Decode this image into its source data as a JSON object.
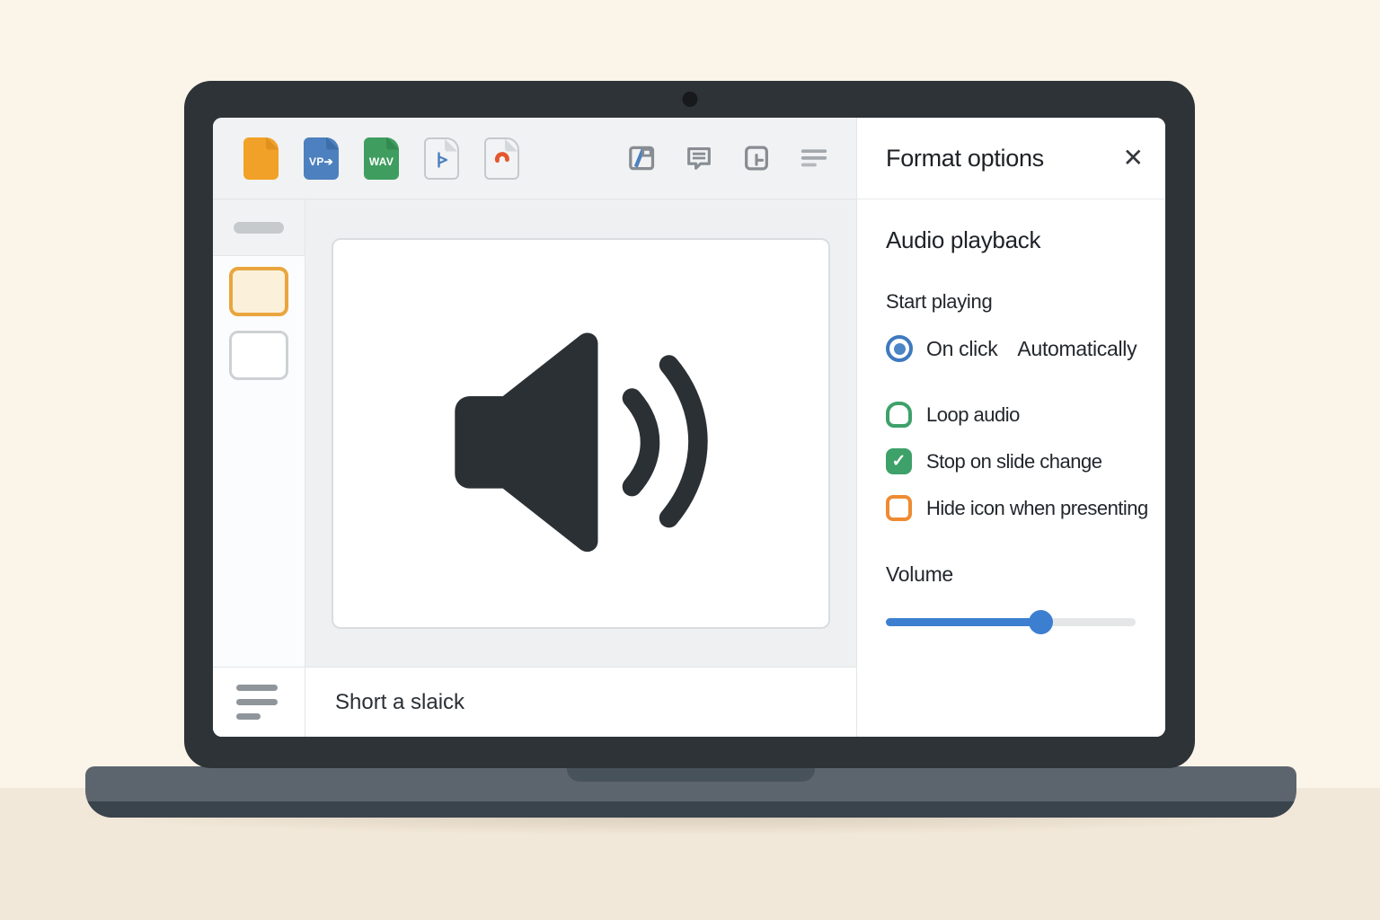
{
  "illustration": {
    "background_top": "#faf4e9",
    "background_floor": "#f2e8d9",
    "laptop_bezel": "#2e3337",
    "laptop_base_top": "#5c656e",
    "laptop_base_bottom": "#3a444d"
  },
  "toolbar": {
    "file_icons": [
      {
        "name": "orange-doc",
        "label": ""
      },
      {
        "name": "blue-doc",
        "label": "VP➔"
      },
      {
        "name": "green-doc",
        "label": "WAV"
      },
      {
        "name": "play-doc",
        "label": ""
      },
      {
        "name": "swirl-doc",
        "label": ""
      }
    ],
    "action_icons": [
      "present",
      "comment",
      "new-window",
      "menu"
    ]
  },
  "sidebar": {
    "thumbnails": [
      {
        "selected": true
      },
      {
        "selected": false
      }
    ]
  },
  "slide": {
    "content": "speaker-audio-icon"
  },
  "notes": {
    "text": "Short a slaick"
  },
  "panel": {
    "title": "Format options",
    "close_glyph": "✕",
    "section_title": "Audio playback",
    "start_playing_label": "Start playing",
    "radio_options": [
      {
        "label": "On click",
        "selected": true
      },
      {
        "label": "Automatically",
        "selected": false
      }
    ],
    "checkboxes": [
      {
        "label": "Loop audio",
        "checked": false,
        "accent": "#3da169"
      },
      {
        "label": "Stop on slide change",
        "checked": true,
        "accent": "#3da169"
      },
      {
        "label": "Hide icon when presenting",
        "checked": false,
        "accent": "#ee8b33"
      }
    ],
    "check_glyph": "✓",
    "volume_label": "Volume",
    "volume_percent": 62,
    "accent_blue": "#3c7fd0",
    "radio_blue": "#3f79c0"
  }
}
